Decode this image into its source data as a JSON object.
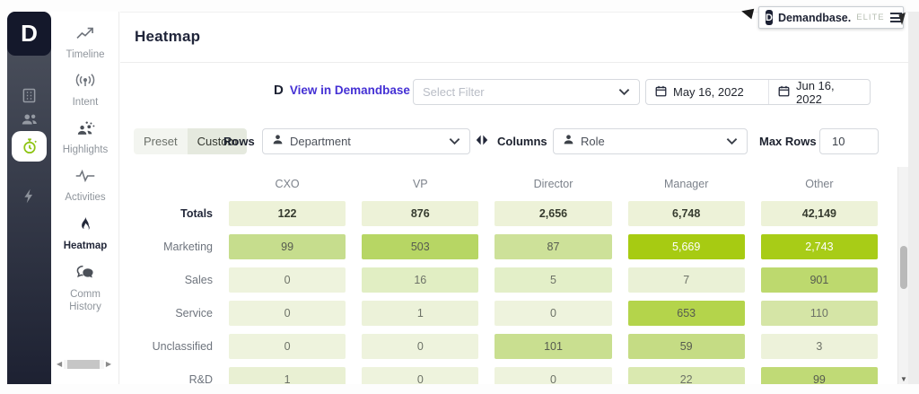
{
  "app": {
    "page_title": "Heatmap",
    "brand_badge": {
      "logo_letter": "D",
      "name": "Demandbase.",
      "tier": "ELITE"
    }
  },
  "primary_sidebar": {
    "logo_letter": "D",
    "items": [
      {
        "icon": "building-icon",
        "active": false
      },
      {
        "icon": "people-icon",
        "active": false
      },
      {
        "icon": "stopwatch-icon",
        "active": true
      },
      {
        "icon": "lightning-icon",
        "active": false
      }
    ]
  },
  "secondary_sidebar": {
    "items": [
      {
        "label": "Timeline",
        "icon": "trend-line-icon",
        "active": false
      },
      {
        "label": "Intent",
        "icon": "broadcast-icon",
        "active": false
      },
      {
        "label": "Highlights",
        "icon": "people-group-icon",
        "active": false
      },
      {
        "label": "Activities",
        "icon": "pulse-icon",
        "active": false
      },
      {
        "label": "Heatmap",
        "icon": "flame-icon",
        "active": true
      },
      {
        "label": "Comm History",
        "icon": "chat-bubbles-icon",
        "active": false
      }
    ]
  },
  "toolbar": {
    "view_link_label": "View in Demandbase",
    "filter_placeholder": "Select Filter",
    "date_start": "May 16, 2022",
    "date_end": "Jun 16, 2022"
  },
  "controls": {
    "preset_label": "Preset",
    "custom_label": "Custom",
    "mode_selected": "Custom",
    "rows_label": "Rows",
    "rows_value": "Department",
    "columns_label": "Columns",
    "columns_value": "Role",
    "max_rows_label": "Max Rows",
    "max_rows_value": "10"
  },
  "colors": {
    "accent_green": "#8dc412",
    "heatmap_max": "#a7cb12",
    "link_purple": "#4430d4",
    "dark_navy": "#1b2033"
  },
  "chart_data": {
    "type": "heatmap",
    "title": "Heatmap",
    "columns": [
      "CXO",
      "VP",
      "Director",
      "Manager",
      "Other"
    ],
    "row_labels": [
      "Totals",
      "Marketing",
      "Sales",
      "Service",
      "Unclassified",
      "R&D"
    ],
    "values": [
      [
        122,
        876,
        2656,
        6748,
        42149
      ],
      [
        99,
        503,
        87,
        5669,
        2743
      ],
      [
        0,
        16,
        5,
        7,
        901
      ],
      [
        0,
        1,
        0,
        653,
        110
      ],
      [
        0,
        0,
        101,
        59,
        3
      ],
      [
        1,
        0,
        0,
        22,
        99
      ]
    ],
    "rows": [
      {
        "label": "Totals",
        "is_totals": true,
        "cells": [
          {
            "v": "122",
            "bg": "#edf2d8",
            "fg": "#363b2f"
          },
          {
            "v": "876",
            "bg": "#edf2d8",
            "fg": "#363b2f"
          },
          {
            "v": "2,656",
            "bg": "#edf2d8",
            "fg": "#363b2f"
          },
          {
            "v": "6,748",
            "bg": "#edf2d8",
            "fg": "#363b2f"
          },
          {
            "v": "42,149",
            "bg": "#edf2d8",
            "fg": "#363b2f"
          }
        ]
      },
      {
        "label": "Marketing",
        "is_totals": false,
        "cells": [
          {
            "v": "99",
            "bg": "#c6dd8d",
            "fg": "#565b50"
          },
          {
            "v": "503",
            "bg": "#b7d664",
            "fg": "#565b50"
          },
          {
            "v": "87",
            "bg": "#cde199",
            "fg": "#565b50"
          },
          {
            "v": "5,669",
            "bg": "#a7cb12",
            "fg": "#ffffff"
          },
          {
            "v": "2,743",
            "bg": "#a8cc17",
            "fg": "#ffffff"
          }
        ]
      },
      {
        "label": "Sales",
        "is_totals": false,
        "cells": [
          {
            "v": "0",
            "bg": "#eef3dd",
            "fg": "#6d7267"
          },
          {
            "v": "16",
            "bg": "#e1eec3",
            "fg": "#6d7267"
          },
          {
            "v": "5",
            "bg": "#e3efc8",
            "fg": "#6d7267"
          },
          {
            "v": "7",
            "bg": "#eaf1d6",
            "fg": "#6d7267"
          },
          {
            "v": "901",
            "bg": "#bdd96e",
            "fg": "#565b50"
          }
        ]
      },
      {
        "label": "Service",
        "is_totals": false,
        "cells": [
          {
            "v": "0",
            "bg": "#eef3dd",
            "fg": "#6d7267"
          },
          {
            "v": "1",
            "bg": "#ecf2d9",
            "fg": "#6d7267"
          },
          {
            "v": "0",
            "bg": "#eef3dd",
            "fg": "#6d7267"
          },
          {
            "v": "653",
            "bg": "#b4d44b",
            "fg": "#565b50"
          },
          {
            "v": "110",
            "bg": "#d5e5a6",
            "fg": "#6d7267"
          }
        ]
      },
      {
        "label": "Unclassified",
        "is_totals": false,
        "cells": [
          {
            "v": "0",
            "bg": "#eef3dd",
            "fg": "#6d7267"
          },
          {
            "v": "0",
            "bg": "#eef3dd",
            "fg": "#6d7267"
          },
          {
            "v": "101",
            "bg": "#c9df90",
            "fg": "#565b50"
          },
          {
            "v": "59",
            "bg": "#c5dc84",
            "fg": "#565b50"
          },
          {
            "v": "3",
            "bg": "#edf2da",
            "fg": "#6d7267"
          }
        ]
      },
      {
        "label": "R&D",
        "is_totals": false,
        "cells": [
          {
            "v": "1",
            "bg": "#e9f0d3",
            "fg": "#6d7267"
          },
          {
            "v": "0",
            "bg": "#eef3dd",
            "fg": "#6d7267"
          },
          {
            "v": "0",
            "bg": "#eef3dd",
            "fg": "#6d7267"
          },
          {
            "v": "22",
            "bg": "#dae9b0",
            "fg": "#6d7267"
          },
          {
            "v": "99",
            "bg": "#c0da76",
            "fg": "#565b50"
          }
        ]
      }
    ],
    "legend_position": "none",
    "grid": false
  }
}
